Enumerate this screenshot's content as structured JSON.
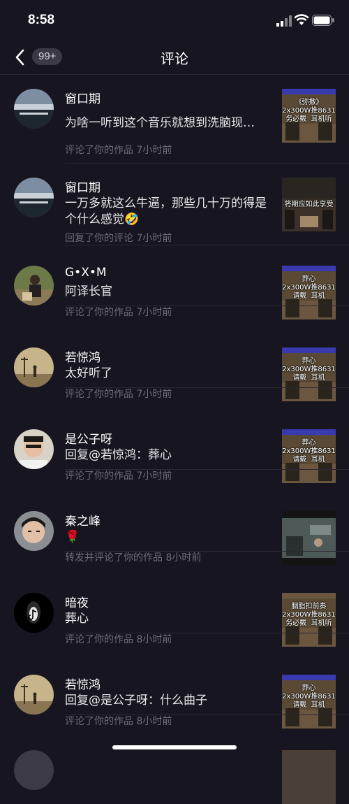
{
  "status": {
    "time": "8:58"
  },
  "header": {
    "badge": "99+",
    "title": "评论"
  },
  "items": [
    {
      "name": "窗口期",
      "content": "为啥一听到这个音乐就想到洗脑现…",
      "meta": "评论了你的作品  7小时前",
      "thumb_text": "《弥撒》\n2x300W推8631\n务必戴  耳机听"
    },
    {
      "name": "窗口期",
      "content": "一万多就这么牛逼，那些几十万的得是个什么感觉🤣",
      "meta": "回复了你的评论  7小时前",
      "thumb_text": "将期应如此享受"
    },
    {
      "name": "G•X•M",
      "content": "阿译长官",
      "meta": "评论了你的作品  7小时前",
      "thumb_text": "葬心\n2x300W推8631\n请戴  耳机"
    },
    {
      "name": "若惊鸿",
      "content": "太好听了",
      "meta": "评论了你的作品  7小时前",
      "thumb_text": "葬心\n2x300W推8631\n请戴  耳机"
    },
    {
      "name": "是公子呀",
      "content": "回复@若惊鸿：葬心",
      "meta": "评论了你的作品  7小时前",
      "thumb_text": "葬心\n2x300W推8631\n请戴  耳机"
    },
    {
      "name": "秦之峰",
      "content": "🌹",
      "meta": "转发并评论了你的作品  8小时前",
      "thumb_text": ""
    },
    {
      "name": "暗夜",
      "content": "葬心",
      "meta": "评论了你的作品  8小时前",
      "thumb_text": "胭脂扣前奏\n2x300W推8631\n务必戴  耳机听"
    },
    {
      "name": "若惊鸿",
      "content": "回复@是公子呀：什么曲子",
      "meta": "评论了你的作品  8小时前",
      "thumb_text": "葬心\n2x300W推8631\n请戴  耳机"
    }
  ]
}
